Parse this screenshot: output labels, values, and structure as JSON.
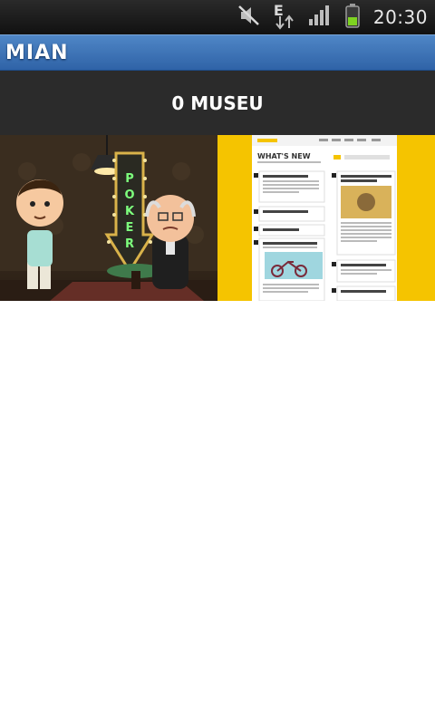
{
  "status_bar": {
    "time": "20:30",
    "network_type": "E",
    "icons": [
      "mute-icon",
      "data-transfer-icon",
      "signal-icon",
      "battery-icon"
    ]
  },
  "app": {
    "title": "MIAN"
  },
  "header": {
    "title": "0 MUSEU"
  },
  "gallery": {
    "items": [
      {
        "name": "poker-cartoon-thumbnail",
        "sign_text": "POKER"
      },
      {
        "name": "website-whats-new-thumbnail",
        "heading": "WHAT'S NEW"
      }
    ]
  },
  "colors": {
    "title_bar": "#3a72b8",
    "header_bg": "#2b2b2b",
    "website_yellow": "#f5c400"
  }
}
